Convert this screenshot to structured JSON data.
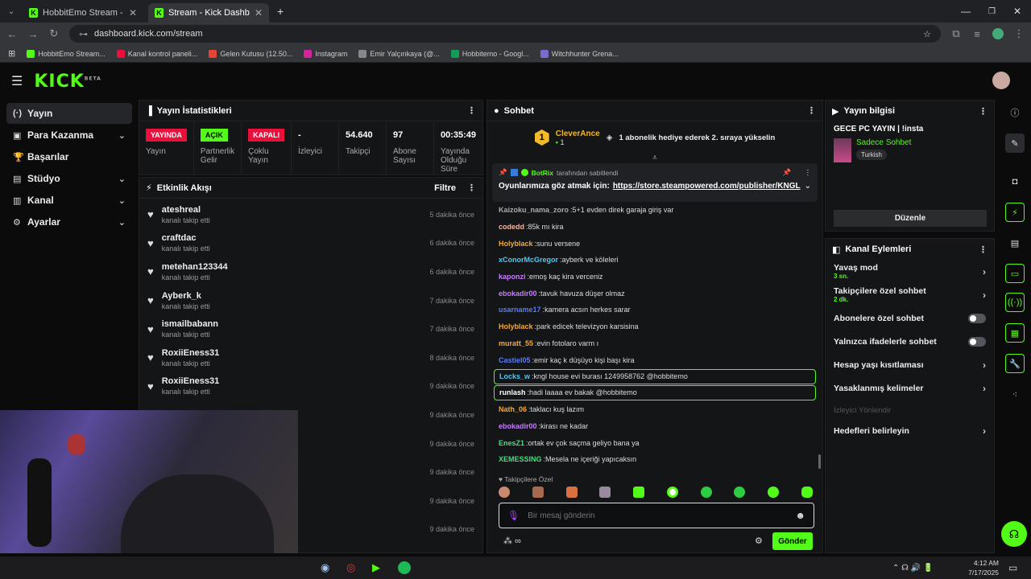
{
  "browser": {
    "tabs": [
      {
        "label": "HobbitEmo Stream - Watch Liv",
        "active": false
      },
      {
        "label": "Stream - Kick Dashboard",
        "active": true
      }
    ],
    "url": "dashboard.kick.com/stream",
    "bookmarks": [
      {
        "label": "HobbitEmo Stream...",
        "color": "#53fc18"
      },
      {
        "label": "Kanal kontrol paneli...",
        "color": "#e9113c"
      },
      {
        "label": "Gelen Kutusu (12.50...",
        "color": "#ea4335"
      },
      {
        "label": "Instagram",
        "color": "#d6249f"
      },
      {
        "label": "Emir Yalçınkaya (@...",
        "color": "#888888"
      },
      {
        "label": "Hobbitemo - Googl...",
        "color": "#0f9d58"
      },
      {
        "label": "Witchhunter Grena...",
        "color": "#7a6bd1"
      }
    ]
  },
  "header": {
    "logo": "KICK",
    "beta": "BETA"
  },
  "sidebar": {
    "items": [
      {
        "label": "Yayın",
        "icon": "broadcast-icon",
        "active": true,
        "chevron": false
      },
      {
        "label": "Para Kazanma",
        "icon": "money-icon",
        "active": false,
        "chevron": true
      },
      {
        "label": "Başarılar",
        "icon": "trophy-icon",
        "active": false,
        "chevron": false
      },
      {
        "label": "Stüdyo",
        "icon": "studio-icon",
        "active": false,
        "chevron": true
      },
      {
        "label": "Kanal",
        "icon": "channel-icon",
        "active": false,
        "chevron": true
      },
      {
        "label": "Ayarlar",
        "icon": "gear-icon",
        "active": false,
        "chevron": true
      }
    ]
  },
  "stats": {
    "title": "Yayın İstatistikleri",
    "items": [
      {
        "value": "YAYINDA",
        "label": "Yayın",
        "badge": "red"
      },
      {
        "value": "AÇIK",
        "label": "Partnerlik Gelir",
        "badge": "green"
      },
      {
        "value": "KAPALI",
        "label": "Çoklu Yayın",
        "badge": "red"
      },
      {
        "value": "-",
        "label": "İzleyici",
        "badge": ""
      },
      {
        "value": "54.640",
        "label": "Takipçi",
        "badge": ""
      },
      {
        "value": "97",
        "label": "Abone Sayısı",
        "badge": ""
      },
      {
        "value": "00:35:49",
        "label": "Yayında Olduğu Süre",
        "badge": ""
      }
    ]
  },
  "activity": {
    "title": "Etkinlik Akışı",
    "filter": "Filtre",
    "items": [
      {
        "user": "ateshreal",
        "action": "kanalı takip etti",
        "time": "5 dakika önce"
      },
      {
        "user": "craftdac",
        "action": "kanalı takip etti",
        "time": "6 dakika önce"
      },
      {
        "user": "metehan123344",
        "action": "kanalı takip etti",
        "time": "6 dakika önce"
      },
      {
        "user": "Ayberk_k",
        "action": "kanalı takip etti",
        "time": "7 dakika önce"
      },
      {
        "user": "ismailbabann",
        "action": "kanalı takip etti",
        "time": "7 dakika önce"
      },
      {
        "user": "RoxiiEness31",
        "action": "kanalı takip etti",
        "time": "8 dakika önce"
      },
      {
        "user": "RoxiiEness31",
        "action": "kanalı takip etti",
        "time": "9 dakika önce"
      },
      {
        "user": "",
        "action": "",
        "time": "9 dakika önce"
      },
      {
        "user": "",
        "action": "",
        "time": "9 dakika önce"
      },
      {
        "user": "",
        "action": "",
        "time": "9 dakika önce"
      },
      {
        "user": "",
        "action": "",
        "time": "9 dakika önce"
      },
      {
        "user": "",
        "action": "",
        "time": "9 dakika önce"
      }
    ]
  },
  "chat": {
    "title": "Sohbet",
    "top_gifter": {
      "name": "CleverAnce",
      "rank": "1",
      "count": "1",
      "message": "1 abonelik hediye ederek 2. sıraya yükselin"
    },
    "pinned": {
      "by": "BotRix",
      "by_suffix": "tarafından sabitlendi",
      "text": "Oyunlarımıza göz atmak için:",
      "link": "https://store.steampowered.com/publisher/KNGL"
    },
    "messages": [
      {
        "user": "Kaizoku_nama_zoro",
        "text": "5+1 evden direk garaja giriş var",
        "color": "#aaaaaa",
        "hl": false
      },
      {
        "user": "codedd",
        "text": "85k mı kira",
        "color": "#f2b8a2",
        "hl": false
      },
      {
        "user": "Holyblack",
        "text": "sunu versene",
        "color": "#f2a93b",
        "hl": false
      },
      {
        "user": "xConorMcGregor",
        "text": "ayberk ve köleleri",
        "color": "#53c7f0",
        "hl": false
      },
      {
        "user": "kaponzi",
        "text": "emoş kaç kira verceniz",
        "color": "#c77dff",
        "hl": false
      },
      {
        "user": "ebokadir00",
        "text": "tavuk havuza düşer olmaz",
        "color": "#c77dff",
        "hl": false
      },
      {
        "user": "usarname17",
        "text": "kamera acsın herkes sarar",
        "color": "#5b7cfa",
        "hl": false
      },
      {
        "user": "Holyblack",
        "text": "park edicek televizyon karsisina",
        "color": "#f2a93b",
        "hl": false
      },
      {
        "user": "muratt_55",
        "text": "evin fotolaro varm ı",
        "color": "#f2a93b",
        "hl": false
      },
      {
        "user": "Castiel05",
        "text": "emir kaç k düşüyo kişi başı kira",
        "color": "#5b7cfa",
        "hl": false
      },
      {
        "user": "Locks_w",
        "text": "kngl house evi burası 1249958762 @hobbitemo",
        "color": "#53c7f0",
        "hl": true
      },
      {
        "user": "runlash",
        "text": "hadi laaaa ev bakak @hobbitemo",
        "color": "#ffffff",
        "hl": true
      },
      {
        "user": "Nath_06",
        "text": "taklacı kuş lazım",
        "color": "#f2a93b",
        "hl": false
      },
      {
        "user": "ebokadir00",
        "text": "kirası ne kadar",
        "color": "#c77dff",
        "hl": false
      },
      {
        "user": "EnesZ1",
        "text": "ortak ev çok saçma geliyo bana ya",
        "color": "#4ade80",
        "hl": false
      },
      {
        "user": "XEMESSING",
        "text": "Mesela ne içeriği yapıcaksın",
        "color": "#4ade80",
        "hl": false
      }
    ],
    "followers_only": "Takipçilere Özel",
    "placeholder": "Bir mesaj gönderin",
    "send": "Gönder"
  },
  "stream_info": {
    "title": "Yayın bilgisi",
    "stream_title": "GECE PC YAYIN | !insta",
    "category": "Sadece Sohbet",
    "tag": "Turkish",
    "edit": "Düzenle"
  },
  "channel_actions": {
    "title": "Kanal Eylemleri",
    "items": [
      {
        "label": "Yavaş mod",
        "sub": "3 sn.",
        "type": "chevron"
      },
      {
        "label": "Takipçilere özel sohbet",
        "sub": "2 dk.",
        "type": "chevron"
      },
      {
        "label": "Abonelere özel sohbet",
        "sub": "",
        "type": "toggle"
      },
      {
        "label": "Yalnızca ifadelerle sohbet",
        "sub": "",
        "type": "toggle"
      },
      {
        "label": "Hesap yaşı kısıtlaması",
        "sub": "",
        "type": "chevron"
      },
      {
        "label": "Yasaklanmış kelimeler",
        "sub": "",
        "type": "chevron"
      },
      {
        "label": "İzleyici Yönlendir",
        "sub": "",
        "type": "disabled"
      },
      {
        "label": "Hedefleri belirleyin",
        "sub": "",
        "type": "chevron"
      }
    ]
  },
  "taskbar": {
    "time": "4:12 AM",
    "date": "7/17/2025"
  },
  "colors": {
    "accent": "#53fc18",
    "live": "#e9113c"
  }
}
